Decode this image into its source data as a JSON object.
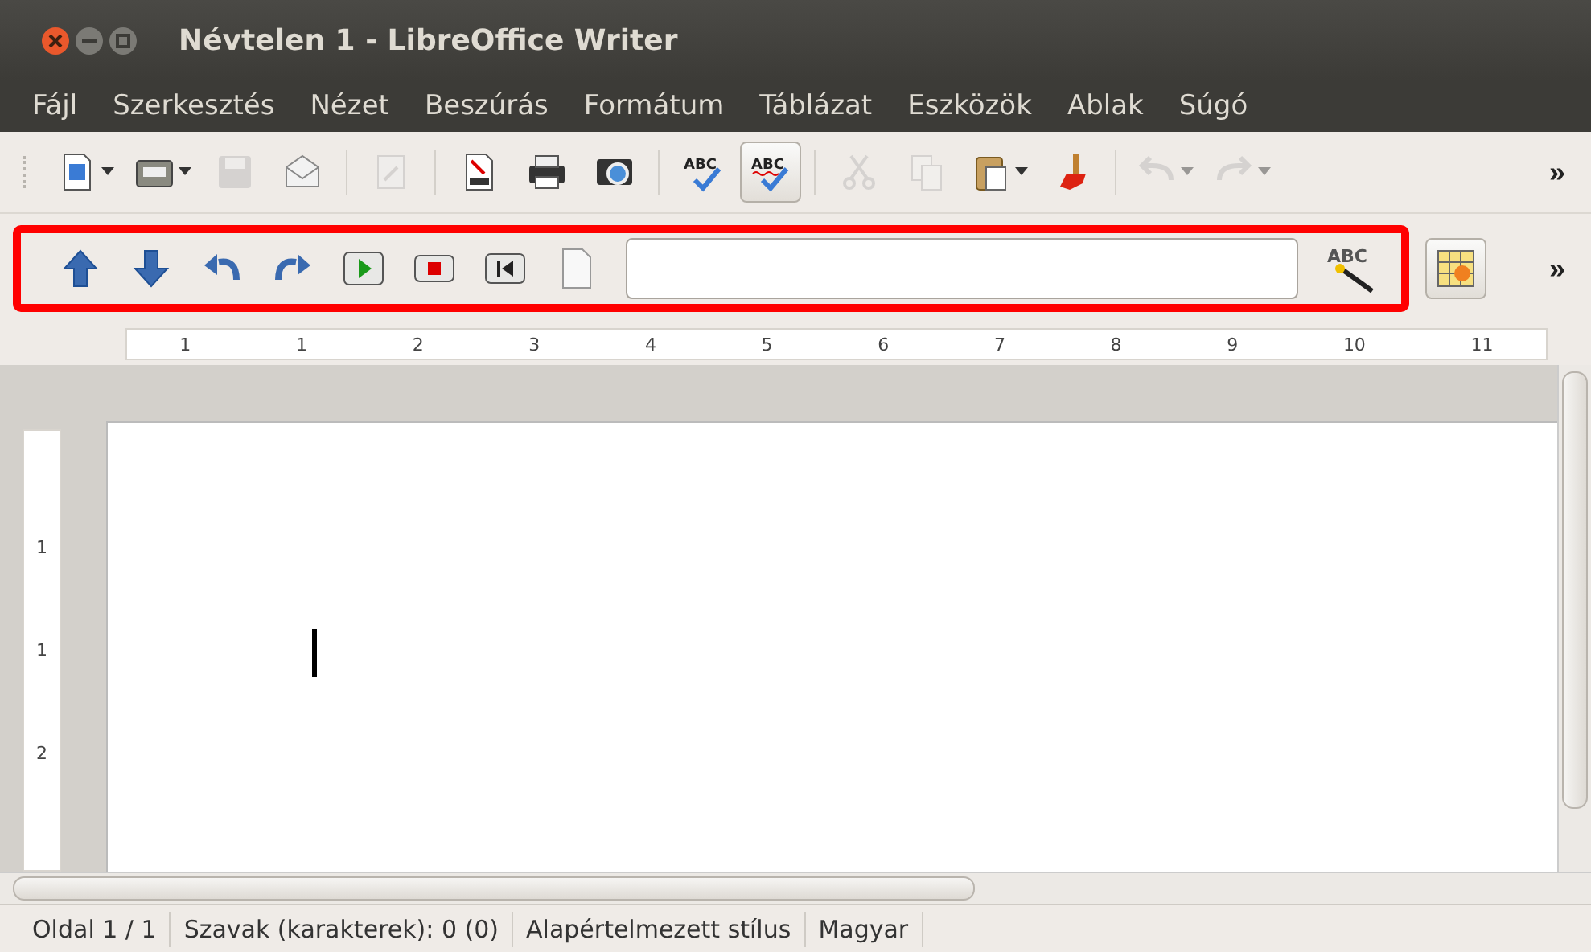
{
  "window": {
    "title": "Névtelen 1 - LibreOffice Writer"
  },
  "menu": [
    "Fájl",
    "Szerkesztés",
    "Nézet",
    "Beszúrás",
    "Formátum",
    "Táblázat",
    "Eszközök",
    "Ablak",
    "Súgó"
  ],
  "standard_toolbar": [
    {
      "kind": "new",
      "disabled": false,
      "dropdown": true
    },
    {
      "kind": "open",
      "disabled": false,
      "dropdown": true
    },
    {
      "kind": "save",
      "disabled": true,
      "dropdown": false
    },
    {
      "kind": "mail",
      "disabled": false,
      "dropdown": false
    },
    {
      "kind": "edit",
      "disabled": true,
      "dropdown": false
    },
    {
      "kind": "pdf",
      "disabled": false,
      "dropdown": false
    },
    {
      "kind": "print",
      "disabled": false,
      "dropdown": false
    },
    {
      "kind": "preview",
      "disabled": false,
      "dropdown": false
    },
    {
      "kind": "spell",
      "disabled": false,
      "dropdown": false,
      "selected": false,
      "icon_text": "ABC"
    },
    {
      "kind": "autospell",
      "disabled": false,
      "dropdown": false,
      "selected": true,
      "icon_text": "ABC"
    },
    {
      "kind": "cut",
      "disabled": true,
      "dropdown": false
    },
    {
      "kind": "copy",
      "disabled": true,
      "dropdown": false
    },
    {
      "kind": "paste",
      "disabled": false,
      "dropdown": true
    },
    {
      "kind": "brush",
      "disabled": false,
      "dropdown": false
    },
    {
      "kind": "undo",
      "disabled": true,
      "dropdown": true
    },
    {
      "kind": "redo",
      "disabled": true,
      "dropdown": true
    }
  ],
  "overflow_label": "»",
  "macro_toolbar": {
    "highlighted": true,
    "buttons": [
      {
        "kind": "up"
      },
      {
        "kind": "down"
      },
      {
        "kind": "back"
      },
      {
        "kind": "forward"
      },
      {
        "kind": "run"
      },
      {
        "kind": "stop"
      },
      {
        "kind": "first"
      },
      {
        "kind": "page"
      }
    ],
    "autocorrect_icon_text": "ABC"
  },
  "extra_toolbar": {
    "selected": true
  },
  "ruler": {
    "labels": [
      "1",
      "1",
      "2",
      "3",
      "4",
      "5",
      "6",
      "7",
      "8",
      "9",
      "10",
      "11"
    ],
    "vertical_labels": [
      "1",
      "1",
      "2"
    ]
  },
  "status_bar": [
    "Oldal 1 / 1",
    "Szavak (karakterek): 0 (0)",
    "Alapértelmezett stílus",
    "Magyar"
  ]
}
